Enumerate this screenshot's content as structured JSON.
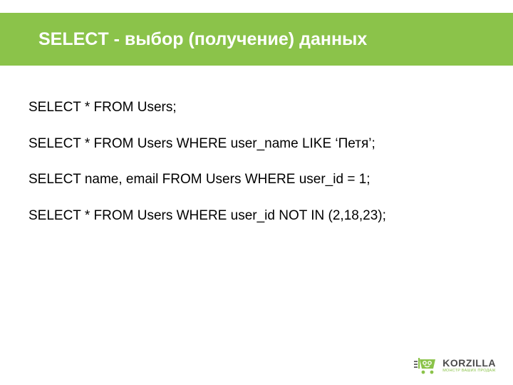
{
  "header": {
    "title": "SELECT   - выбор (получение) данных"
  },
  "queries": [
    "SELECT * FROM Users;",
    "SELECT * FROM Users WHERE user_name LIKE ‘Петя’;",
    "SELECT name, email FROM Users WHERE user_id = 1;",
    "SELECT * FROM Users WHERE user_id NOT IN (2,18,23);"
  ],
  "logo": {
    "name": "KORZILLA",
    "tagline": "МОНСТР ВАШИХ ПРОДАЖ"
  }
}
